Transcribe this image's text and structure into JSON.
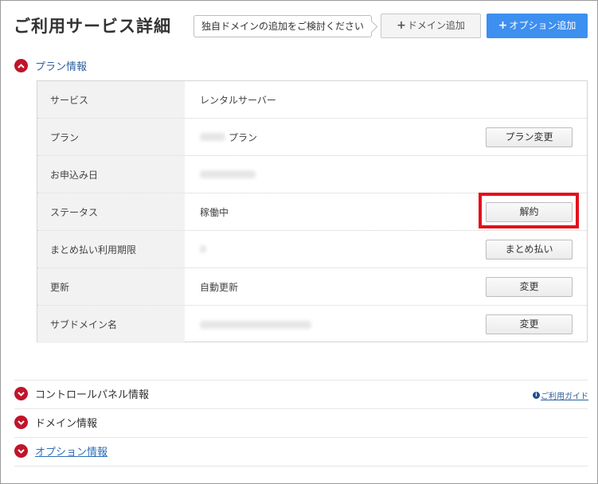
{
  "header": {
    "title": "ご利用サービス詳細",
    "tooltip": "独自ドメインの追加をご検討ください",
    "add_domain_label": "ドメイン追加",
    "add_option_label": "オプション追加",
    "plus_glyph": "+"
  },
  "sections": {
    "plan_info": "プラン情報",
    "control_panel": "コントロールパネル情報",
    "domain_info": "ドメイン情報",
    "option_info": "オプション情報"
  },
  "plan_table": {
    "rows": [
      {
        "label": "サービス",
        "value": "レンタルサーバー",
        "action": ""
      },
      {
        "label": "プラン",
        "value": "プラン",
        "action": "プラン変更"
      },
      {
        "label": "お申込み日",
        "value": "",
        "action": ""
      },
      {
        "label": "ステータス",
        "value": "稼働中",
        "action": "解約"
      },
      {
        "label": "まとめ払い利用期限",
        "value": "",
        "action": "まとめ払い"
      },
      {
        "label": "更新",
        "value": "自動更新",
        "action": "変更"
      },
      {
        "label": "サブドメイン名",
        "value": "",
        "action": "変更"
      }
    ]
  },
  "guide": {
    "label": "ご利用ガイド",
    "icon_glyph": "i"
  },
  "colors": {
    "accent_red": "#c0152a",
    "primary_blue": "#3d8ff0",
    "highlight_red": "#e3101c"
  }
}
